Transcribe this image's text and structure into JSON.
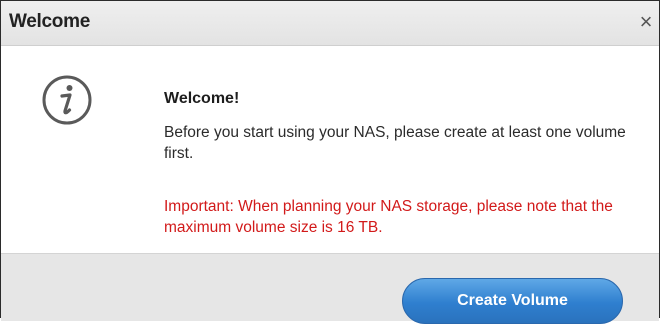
{
  "dialog": {
    "title": "Welcome",
    "close_glyph": "×",
    "heading": "Welcome!",
    "message": "Before you start using your NAS, please create at least one volume first.",
    "important": "Important: When planning your NAS storage, please note that the maximum volume size is 16 TB.",
    "icon": "info-icon",
    "primary_button_label": "Create Volume"
  },
  "colors": {
    "important_text": "#d21a1a",
    "button_blue": "#2f7fcf",
    "footer_bg": "#e6e6e6"
  }
}
